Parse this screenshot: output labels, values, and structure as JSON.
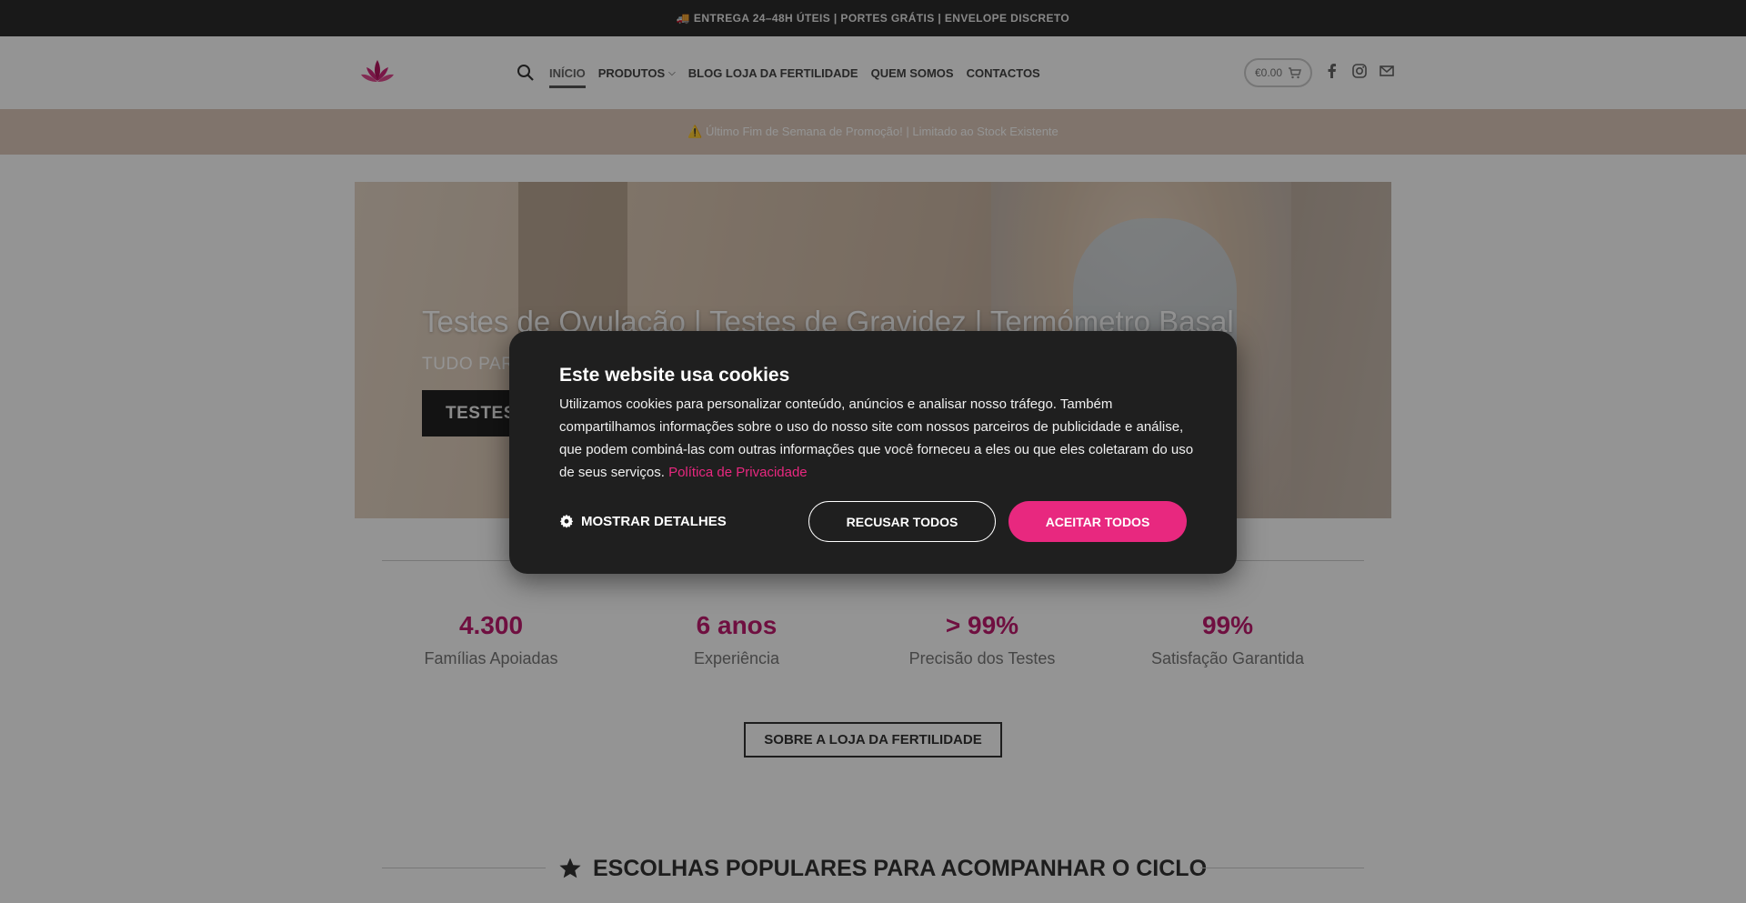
{
  "topbar": {
    "text": "🚚 ENTREGA 24–48H ÚTEIS | PORTES GRÁTIS | ENVELOPE DISCRETO"
  },
  "header": {
    "logo_icon": "lotus-logo-icon",
    "nav": {
      "search_icon": "search-icon",
      "items": [
        {
          "label": "INÍCIO",
          "active": true
        },
        {
          "label": "PRODUTOS",
          "dropdown": true
        },
        {
          "label": "BLOG LOJA DA FERTILIDADE"
        },
        {
          "label": "QUEM SOMOS"
        },
        {
          "label": "CONTACTOS"
        }
      ]
    },
    "cart": {
      "amount": "€0.00",
      "icon": "cart-icon"
    },
    "social": [
      "facebook-icon",
      "instagram-icon",
      "mail-icon"
    ]
  },
  "promo": {
    "text": "⚠️ Último Fim de Semana de Promoção! | Limitado ao Stock Existente"
  },
  "hero": {
    "title": "Testes de Ovulação | Testes de Gravidez | Termómetro Basal",
    "subtitle": "TUDO PAR",
    "button_label": "TESTES"
  },
  "stats": [
    {
      "value": "4.300",
      "label": "Famílias Apoiadas"
    },
    {
      "value": "6 anos",
      "label": "Experiência"
    },
    {
      "value": "> 99%",
      "label": "Precisão dos Testes"
    },
    {
      "value": "99%",
      "label": "Satisfação Garantida"
    }
  ],
  "about_button": "SOBRE A LOJA DA FERTILIDADE",
  "section": {
    "icon": "star-icon",
    "title": "ESCOLHAS POPULARES PARA ACOMPANHAR O CICLO"
  },
  "cookie": {
    "title": "Este website usa cookies",
    "body": "Utilizamos cookies para personalizar conteúdo, anúncios e analisar nosso tráfego. Também compartilhamos informações sobre o uso do nosso site com nossos parceiros de publicidade e análise, que podem combiná-las com outras informações que você forneceu a eles ou que eles coletaram do uso de seus serviços.",
    "link": "Política de Privacidade",
    "details_label": "MOSTRAR DETALHES",
    "details_icon": "gear-icon",
    "reject_label": "RECUSAR TODOS",
    "accept_label": "ACEITAR TODOS"
  },
  "colors": {
    "accent": "#e8287f",
    "stat": "#c01b6f",
    "topbar": "#2b2b2b",
    "promo": "#dcc9bb"
  }
}
